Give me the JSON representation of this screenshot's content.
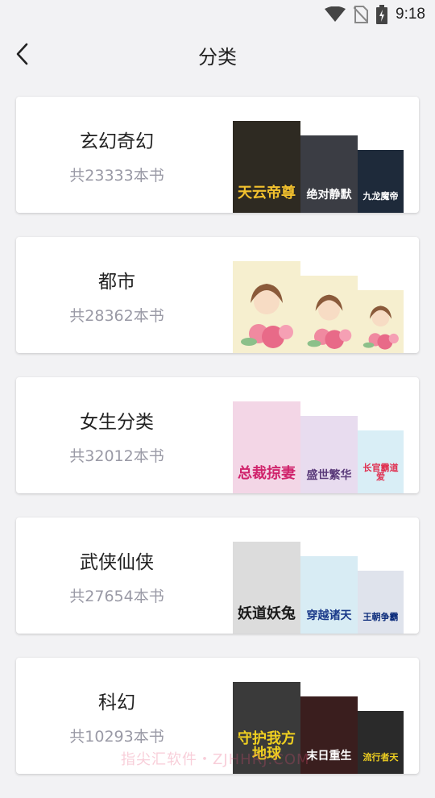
{
  "status_bar": {
    "time": "9:18",
    "icons": [
      "wifi-icon",
      "no-sim-icon",
      "battery-charging-icon"
    ]
  },
  "header": {
    "back_icon": "chevron-left-icon",
    "title": "分类"
  },
  "categories": [
    {
      "name": "玄幻奇幻",
      "count": "共23333本书",
      "covers": [
        {
          "title": "天云帝尊",
          "bg": "#2e2a22",
          "fg": "#f2c12e"
        },
        {
          "title": "绝对静默",
          "bg": "#3b3d44",
          "fg": "#ffffff"
        },
        {
          "title": "九龙魔帝",
          "bg": "#1e2a3a",
          "fg": "#ffffff"
        }
      ]
    },
    {
      "name": "都市",
      "count": "共28362本书",
      "covers": [
        {
          "title": "",
          "bg": "#f6efcf",
          "fg": "#c04060"
        },
        {
          "title": "",
          "bg": "#f6efcf",
          "fg": "#c04060"
        },
        {
          "title": "",
          "bg": "#f6efcf",
          "fg": "#c04060"
        }
      ]
    },
    {
      "name": "女生分类",
      "count": "共32012本书",
      "covers": [
        {
          "title": "总裁掠妻",
          "bg": "#f3d6e6",
          "fg": "#d0246c"
        },
        {
          "title": "盛世繁华",
          "bg": "#e8dcef",
          "fg": "#5a3a7a"
        },
        {
          "title": "长官霸道爱",
          "bg": "#d9eef6",
          "fg": "#e03050"
        }
      ]
    },
    {
      "name": "武侠仙侠",
      "count": "共27654本书",
      "covers": [
        {
          "title": "妖道妖兔",
          "bg": "#dcdcdc",
          "fg": "#1a1a1a"
        },
        {
          "title": "穿越诸天",
          "bg": "#d8ecf4",
          "fg": "#1a3a8a"
        },
        {
          "title": "王朝争霸",
          "bg": "#dfe3ec",
          "fg": "#0a2a7a"
        }
      ]
    },
    {
      "name": "科幻",
      "count": "共10293本书",
      "covers": [
        {
          "title": "守护我方地球",
          "bg": "#3a3a3a",
          "fg": "#f0d020"
        },
        {
          "title": "末日重生",
          "bg": "#3a1e1e",
          "fg": "#ffffff"
        },
        {
          "title": "流行者天",
          "bg": "#2a2a2a",
          "fg": "#f0d020"
        }
      ]
    }
  ],
  "watermark": "指尖汇软件・ZJHHRJ.COM",
  "colors": {
    "background": "#f2f2f4",
    "card": "#ffffff",
    "title_text": "#222222",
    "count_text": "#9a9aa6"
  }
}
